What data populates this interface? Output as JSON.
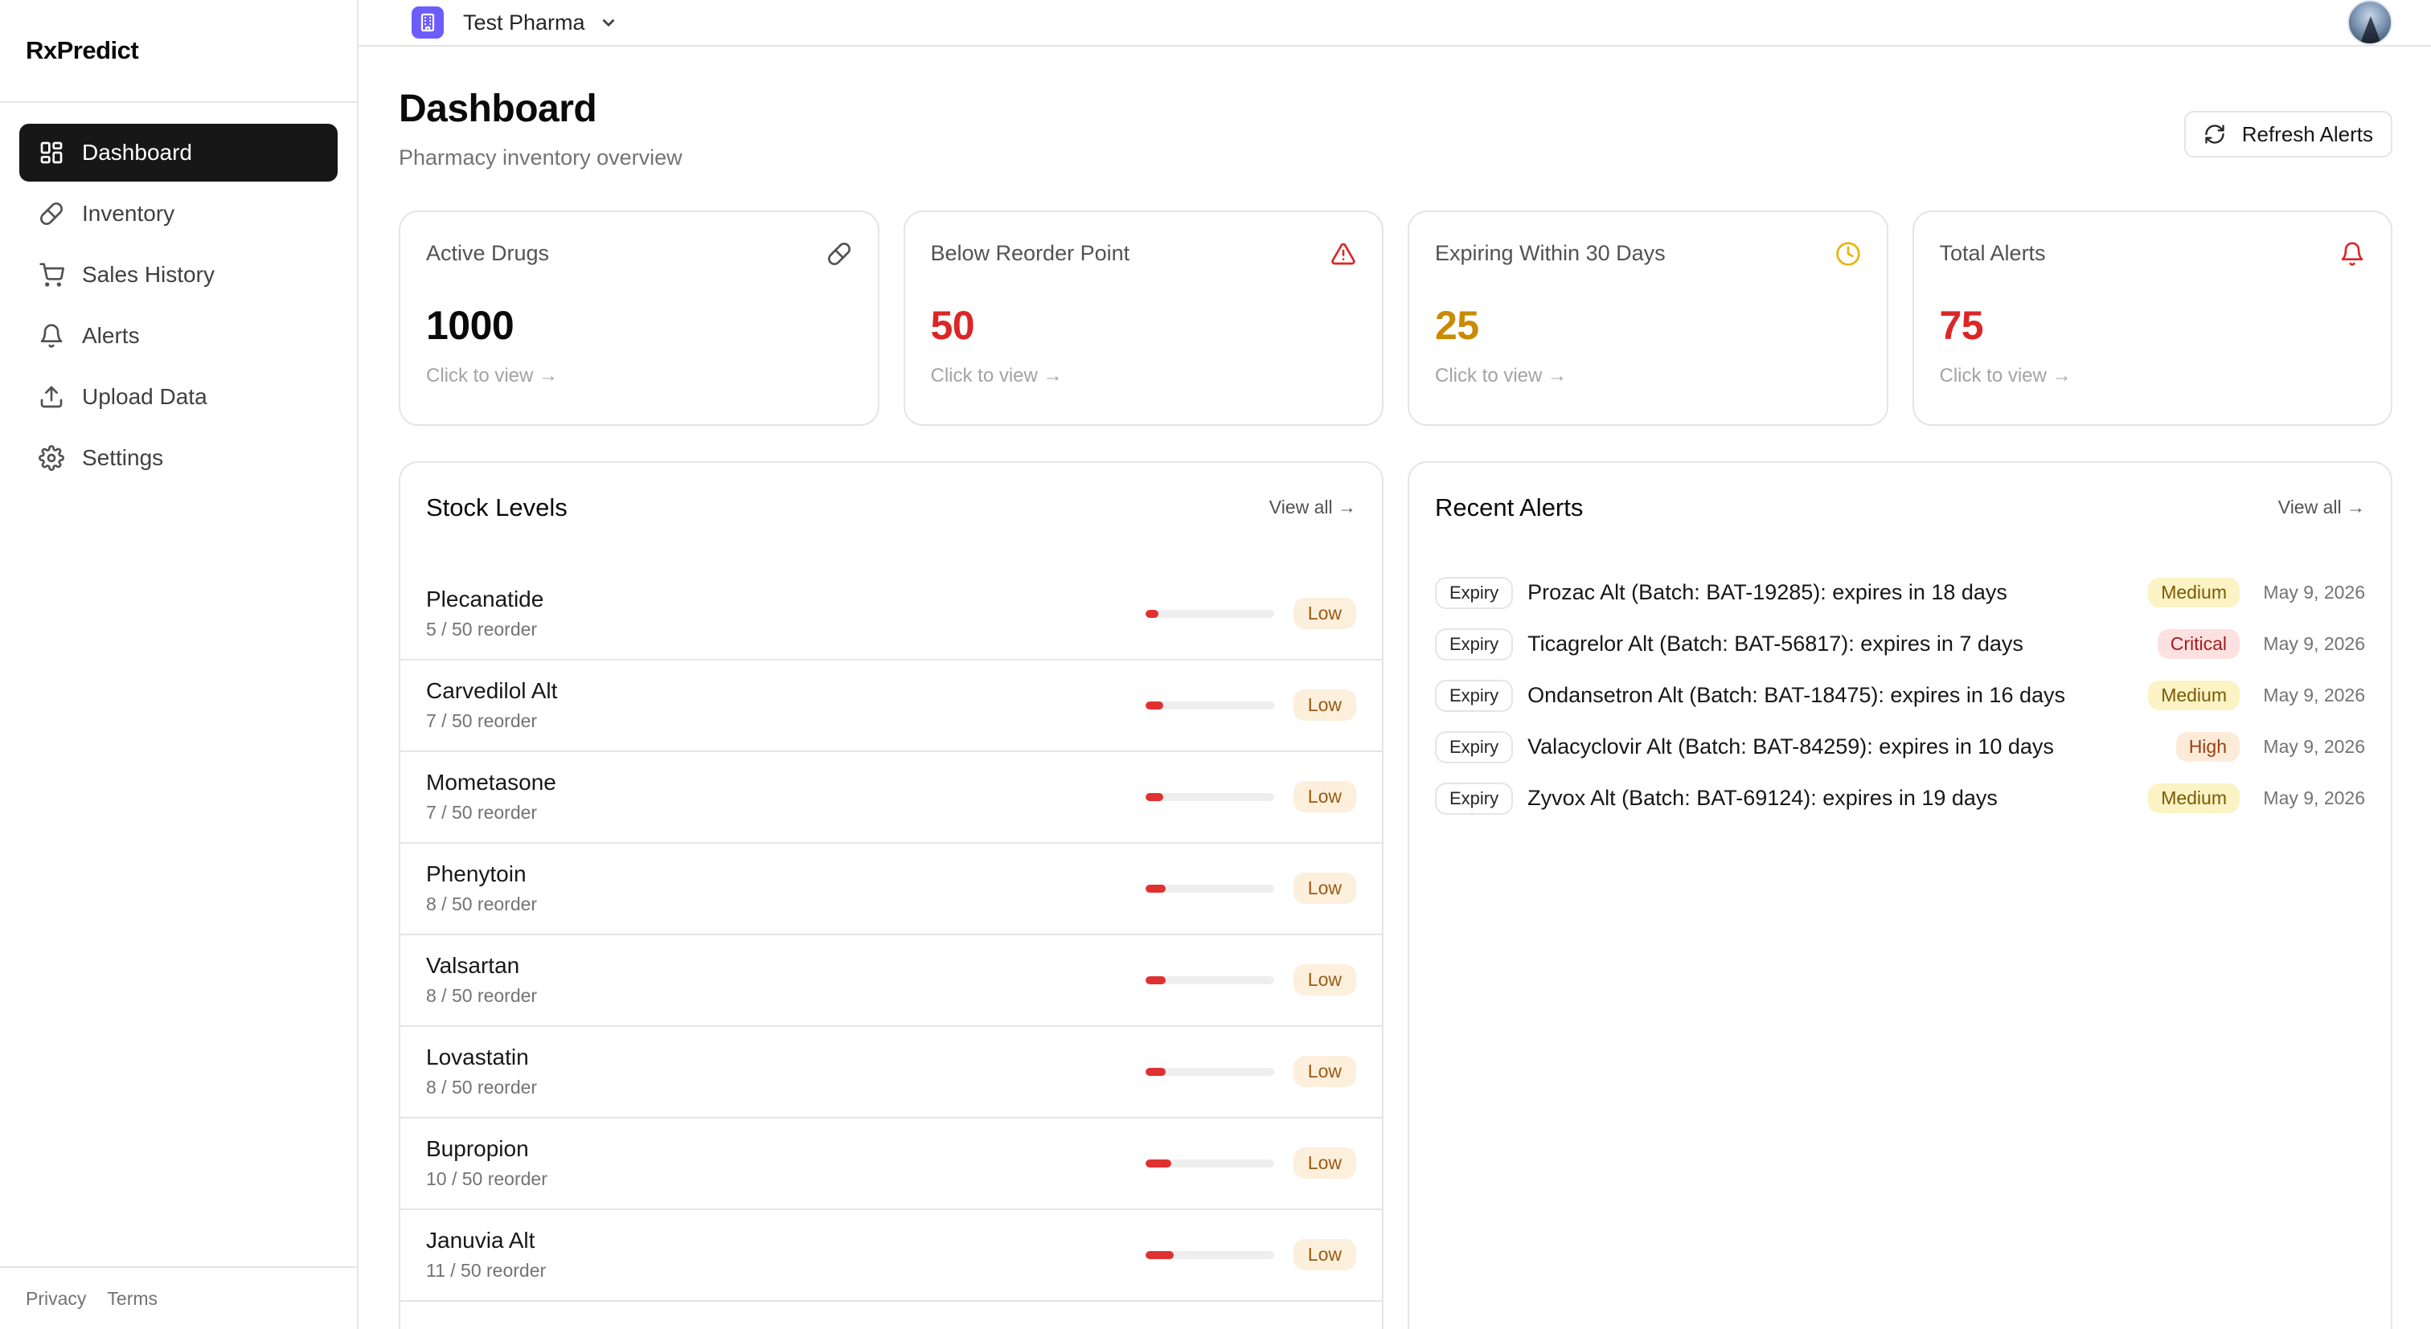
{
  "app": {
    "brand": "RxPredict"
  },
  "sidebar": {
    "items": [
      {
        "label": "Dashboard",
        "icon": "dashboard-icon",
        "active": true
      },
      {
        "label": "Inventory",
        "icon": "pill-icon"
      },
      {
        "label": "Sales History",
        "icon": "cart-icon"
      },
      {
        "label": "Alerts",
        "icon": "bell-icon"
      },
      {
        "label": "Upload Data",
        "icon": "upload-icon"
      },
      {
        "label": "Settings",
        "icon": "gear-icon"
      }
    ],
    "footer": {
      "privacy": "Privacy",
      "terms": "Terms"
    }
  },
  "topbar": {
    "org_name": "Test Pharma",
    "org_icon": "building-icon"
  },
  "page": {
    "title": "Dashboard",
    "subtitle": "Pharmacy inventory overview",
    "refresh_label": "Refresh Alerts"
  },
  "stats": [
    {
      "label": "Active Drugs",
      "value": "1000",
      "link": "Click to view →",
      "icon": "pill-icon",
      "color": "#0a0a0a",
      "icon_color": "#525252"
    },
    {
      "label": "Below Reorder Point",
      "value": "50",
      "link": "Click to view →",
      "icon": "warning-icon",
      "color": "#dc2626",
      "icon_color": "#dc2626"
    },
    {
      "label": "Expiring Within 30 Days",
      "value": "25",
      "link": "Click to view →",
      "icon": "clock-icon",
      "color": "#ca8a04",
      "icon_color": "#eab308"
    },
    {
      "label": "Total Alerts",
      "value": "75",
      "link": "Click to view →",
      "icon": "bell-icon",
      "color": "#dc2626",
      "icon_color": "#dc2626"
    }
  ],
  "stock": {
    "title": "Stock Levels",
    "view_all": "View all →",
    "items": [
      {
        "name": "Plecanatide",
        "meta": "5 / 50 reorder",
        "ratio": 0.1,
        "status": "Low"
      },
      {
        "name": "Carvedilol Alt",
        "meta": "7 / 50 reorder",
        "ratio": 0.14,
        "status": "Low"
      },
      {
        "name": "Mometasone",
        "meta": "7 / 50 reorder",
        "ratio": 0.14,
        "status": "Low"
      },
      {
        "name": "Phenytoin",
        "meta": "8 / 50 reorder",
        "ratio": 0.16,
        "status": "Low"
      },
      {
        "name": "Valsartan",
        "meta": "8 / 50 reorder",
        "ratio": 0.16,
        "status": "Low"
      },
      {
        "name": "Lovastatin",
        "meta": "8 / 50 reorder",
        "ratio": 0.16,
        "status": "Low"
      },
      {
        "name": "Bupropion",
        "meta": "10 / 50 reorder",
        "ratio": 0.2,
        "status": "Low"
      },
      {
        "name": "Januvia Alt",
        "meta": "11 / 50 reorder",
        "ratio": 0.22,
        "status": "Low"
      }
    ]
  },
  "alerts": {
    "title": "Recent Alerts",
    "view_all": "View all →",
    "items": [
      {
        "type": "Expiry",
        "message": "Prozac Alt (Batch: BAT-19285): expires in 18 days",
        "severity": "Medium",
        "date": "May 9, 2026"
      },
      {
        "type": "Expiry",
        "message": "Ticagrelor Alt (Batch: BAT-56817): expires in 7 days",
        "severity": "Critical",
        "date": "May 9, 2026"
      },
      {
        "type": "Expiry",
        "message": "Ondansetron Alt (Batch: BAT-18475): expires in 16 days",
        "severity": "Medium",
        "date": "May 9, 2026"
      },
      {
        "type": "Expiry",
        "message": "Valacyclovir Alt (Batch: BAT-84259): expires in 10 days",
        "severity": "High",
        "date": "May 9, 2026"
      },
      {
        "type": "Expiry",
        "message": "Zyvox Alt (Batch: BAT-69124): expires in 19 days",
        "severity": "Medium",
        "date": "May 9, 2026"
      }
    ]
  }
}
